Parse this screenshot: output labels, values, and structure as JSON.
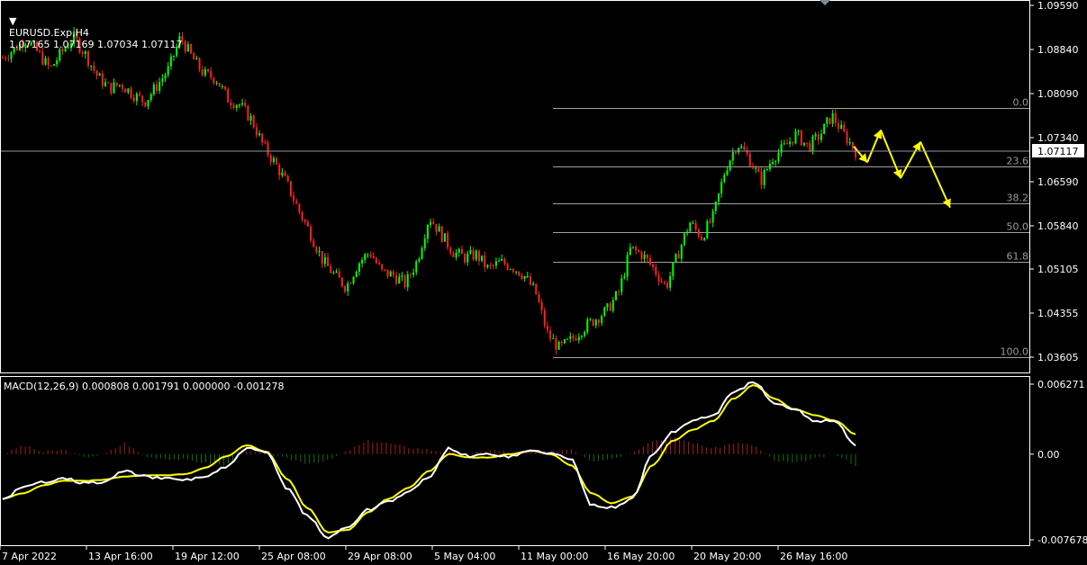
{
  "header": {
    "symbol": "EURUSD.Exp,H4",
    "ohlc": "1.07165 1.07169 1.07034 1.07117"
  },
  "macd_header": "MACD(12,26,9) 0.000808 0.001791 0.000000 -0.001278",
  "colors": {
    "background": "#000000",
    "bull": "#00ff00",
    "bear": "#ff2020",
    "signal_line": "#ffff00",
    "macd_line": "#ffffff",
    "fib_line": "#a0a0a0",
    "arrow": "#ffff00",
    "hist_pos": "#a02020",
    "hist_neg": "#107010"
  },
  "chart_data": [
    {
      "type": "candlestick",
      "title": "EURUSD.Exp,H4",
      "y_ticks": [
        "1.09590",
        "1.08840",
        "1.08090",
        "1.07340",
        "1.06590",
        "1.05840",
        "1.05105",
        "1.04355",
        "1.03605"
      ],
      "ylim": [
        1.0335,
        1.097
      ],
      "x_ticks": [
        "7 Apr 2022",
        "13 Apr 16:00",
        "19 Apr 12:00",
        "25 Apr 08:00",
        "29 Apr 08:00",
        "5 May 04:00",
        "11 May 00:00",
        "16 May 20:00",
        "20 May 20:00",
        "26 May 16:00"
      ],
      "current_price": "1.07117",
      "current_price_value": 1.07117,
      "close_path": [
        1.087,
        1.0885,
        1.0902,
        1.0878,
        1.085,
        1.088,
        1.0905,
        1.0875,
        1.0838,
        1.0818,
        1.0825,
        1.0808,
        1.0795,
        1.0822,
        1.085,
        1.0905,
        1.087,
        1.0842,
        1.0835,
        1.08,
        1.079,
        1.0765,
        1.072,
        1.069,
        1.0655,
        1.061,
        1.057,
        1.0525,
        1.05,
        1.048,
        1.052,
        1.054,
        1.0505,
        1.05,
        1.0485,
        1.0525,
        1.06,
        1.057,
        1.054,
        1.053,
        1.0535,
        1.051,
        1.0522,
        1.0515,
        1.05,
        1.047,
        1.04,
        1.0375,
        1.039,
        1.041,
        1.0425,
        1.044,
        1.047,
        1.0545,
        1.0535,
        1.051,
        1.048,
        1.0535,
        1.059,
        1.0565,
        1.06,
        1.068,
        1.0725,
        1.07,
        1.066,
        1.07,
        1.0718,
        1.074,
        1.0718,
        1.0738,
        1.0772,
        1.074,
        1.0712
      ],
      "fibonacci": [
        {
          "level": "0.0",
          "price": 1.0785
        },
        {
          "level": "23.6",
          "price": 1.0685
        },
        {
          "level": "38.2",
          "price": 1.0623
        },
        {
          "level": "50.0",
          "price": 1.0573
        },
        {
          "level": "61.8",
          "price": 1.0523
        },
        {
          "level": "100.0",
          "price": 1.036
        }
      ],
      "projection_path": [
        1.0719,
        1.0692,
        1.0747,
        1.0665,
        1.0727,
        1.0615
      ]
    },
    {
      "type": "line",
      "title": "MACD(12,26,9)",
      "y_ticks": [
        "0.006271",
        "0.00",
        "-0.007678"
      ],
      "ylim": [
        -0.007678,
        0.006271
      ],
      "series": [
        {
          "name": "MACD",
          "values": [
            -0.004,
            -0.003,
            -0.0025,
            -0.0021,
            -0.0026,
            -0.0025,
            -0.0015,
            -0.002,
            -0.0022,
            -0.0023,
            -0.002,
            -0.0012,
            0.0005,
            0.0001,
            -0.003,
            -0.0055,
            -0.0075,
            -0.0065,
            -0.005,
            -0.0042,
            -0.0034,
            -0.002,
            0.0005,
            -0.0002,
            0.0,
            -0.0002,
            0.0003,
            0.0001,
            -0.0005,
            -0.0045,
            -0.0048,
            -0.004,
            0.0,
            0.002,
            0.003,
            0.0035,
            0.0055,
            0.0065,
            0.0045,
            0.004,
            0.003,
            0.003,
            0.0008
          ]
        },
        {
          "name": "Signal",
          "values": [
            -0.004,
            -0.0035,
            -0.0028,
            -0.0024,
            -0.0024,
            -0.0023,
            -0.002,
            -0.0019,
            -0.0019,
            -0.0018,
            -0.0012,
            -0.0002,
            0.0008,
            0.0002,
            -0.0022,
            -0.0048,
            -0.007,
            -0.0068,
            -0.0052,
            -0.004,
            -0.003,
            -0.0015,
            0.0,
            -0.0003,
            -0.0003,
            0.0,
            0.0003,
            0.0,
            -0.001,
            -0.0035,
            -0.0044,
            -0.0038,
            -0.001,
            0.0012,
            0.0022,
            0.003,
            0.005,
            0.0062,
            0.005,
            0.004,
            0.0035,
            0.003,
            0.0018
          ]
        },
        {
          "name": "Histogram",
          "values": [
            0.0,
            0.0008,
            0.0002,
            0.0004,
            -0.0003,
            0.0,
            0.001,
            -0.0002,
            -0.0004,
            -0.0005,
            -0.0008,
            -0.001,
            0.0002,
            0.0,
            -0.0004,
            -0.0008,
            -0.0006,
            0.0003,
            0.0012,
            0.001,
            0.0006,
            0.0004,
            0.0002,
            0.0,
            0.0004,
            0.0002,
            0.0001,
            0.0002,
            0.0005,
            -0.0006,
            -0.0004,
            0.0002,
            0.0012,
            0.0015,
            0.001,
            0.0005,
            0.001,
            0.0008,
            -0.0006,
            -0.0008,
            -0.0004,
            0.0,
            -0.001
          ]
        }
      ]
    }
  ]
}
